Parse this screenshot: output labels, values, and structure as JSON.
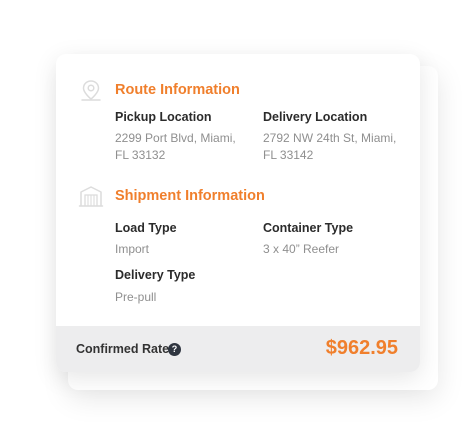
{
  "colors": {
    "accent": "#f07f2c",
    "icon": "#dcdcdc"
  },
  "icons": {
    "route": "map-pin-icon",
    "shipment": "warehouse-icon",
    "help": "question-circle-icon"
  },
  "route": {
    "title": "Route Information",
    "pickup_label": "Pickup Location",
    "pickup_line1": "2299 Port Blvd, Miami,",
    "pickup_line2": "FL 33132",
    "delivery_label": "Delivery Location",
    "delivery_line1": "2792 NW 24th St, Miami,",
    "delivery_line2": "FL 33142"
  },
  "shipment": {
    "title": "Shipment Information",
    "load_type_label": "Load Type",
    "load_type_value": "Import",
    "container_type_label": "Container Type",
    "container_type_value": "3 x 40” Reefer",
    "delivery_type_label": "Delivery Type",
    "delivery_type_value": "Pre-pull"
  },
  "footer": {
    "label": "Confirmed Rate",
    "help_symbol": "?",
    "amount": "$962.95"
  }
}
